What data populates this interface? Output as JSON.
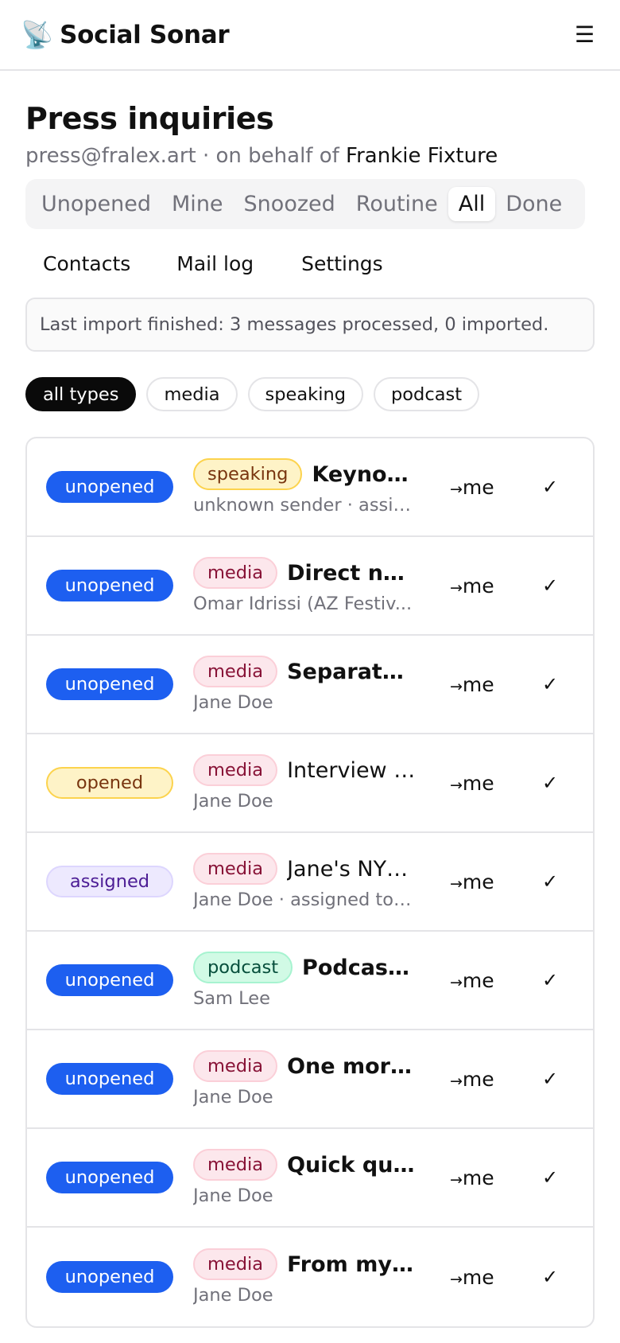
{
  "app": {
    "icon": "📡",
    "name": "Social Sonar",
    "menu_icon": "☰"
  },
  "page": {
    "title": "Press inquiries",
    "subtitle_prefix": "press@fralex.art · on behalf of ",
    "owner": "Frankie Fixture"
  },
  "tabs": [
    "Unopened",
    "Mine",
    "Snoozed",
    "Routine",
    "All",
    "Done"
  ],
  "active_tab": "All",
  "secondary_nav": [
    "Contacts",
    "Mail log",
    "Settings"
  ],
  "notice": "Last import finished: 3 messages processed, 0 imported.",
  "filters": [
    "all types",
    "media",
    "speaking",
    "podcast"
  ],
  "active_filter": "all types",
  "assign_arrow": "→",
  "assign_label": "me",
  "done_glyph": "✓",
  "rows": [
    {
      "status": "unopened",
      "tag": "speaking",
      "subject": "Keynote...",
      "bold": true,
      "sender": "unknown sender · assig..."
    },
    {
      "status": "unopened",
      "tag": "media",
      "subject": "Direct note",
      "bold": true,
      "sender": "Omar Idrissi (AZ Festiv..."
    },
    {
      "status": "unopened",
      "tag": "media",
      "subject": "Separate ...",
      "bold": true,
      "sender": "Jane Doe"
    },
    {
      "status": "opened",
      "tag": "media",
      "subject": "Interview r...",
      "bold": false,
      "sender": "Jane Doe"
    },
    {
      "status": "assigned",
      "tag": "media",
      "subject": "Jane's NYT...",
      "bold": false,
      "sender": "Jane Doe · assigned to ..."
    },
    {
      "status": "unopened",
      "tag": "podcast",
      "subject": "Podcast ...",
      "bold": true,
      "sender": "Sam Lee"
    },
    {
      "status": "unopened",
      "tag": "media",
      "subject": "One more ...",
      "bold": true,
      "sender": "Jane Doe"
    },
    {
      "status": "unopened",
      "tag": "media",
      "subject": "Quick que...",
      "bold": true,
      "sender": "Jane Doe"
    },
    {
      "status": "unopened",
      "tag": "media",
      "subject": "From my n...",
      "bold": true,
      "sender": "Jane Doe"
    }
  ]
}
